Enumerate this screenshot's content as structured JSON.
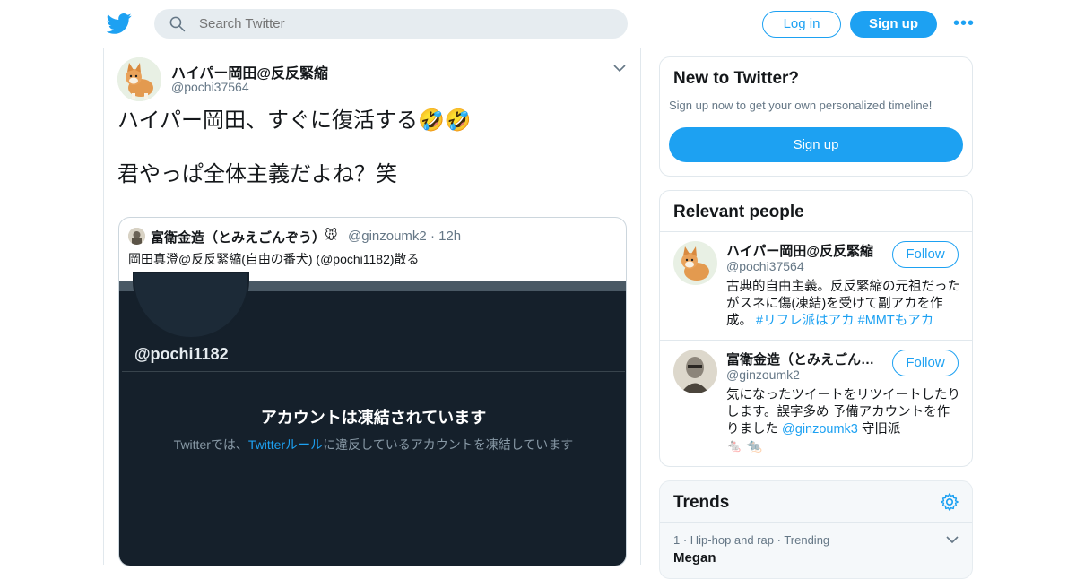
{
  "header": {
    "search_placeholder": "Search Twitter",
    "login_label": "Log in",
    "signup_label": "Sign up",
    "more_label": "•••"
  },
  "tweet": {
    "author_name": "ハイパー岡田@反反緊縮",
    "author_handle": "@pochi37564",
    "text": "ハイパー岡田、すぐに復活する🤣🤣\n\n君やっぱ全体主義だよね？笑",
    "quote": {
      "author_name": "富衛金造（とみえごんぞう）",
      "author_emoji": "🐭",
      "author_handle": "@ginzoumk2",
      "time": "· 12h",
      "text": "岡田真澄@反反緊縮(自由の番犬) (@pochi1182)散る",
      "card": {
        "handle": "@pochi1182",
        "title": "アカウントは凍結されています",
        "sub_prefix": "Twitterでは、",
        "sub_link": "Twitterルール",
        "sub_suffix": "に違反しているアカウントを凍結しています"
      }
    }
  },
  "sidebar": {
    "new_to_twitter": {
      "title": "New to Twitter?",
      "subtitle": "Sign up now to get your own personalized timeline!",
      "button": "Sign up"
    },
    "relevant_people": {
      "title": "Relevant people",
      "people": [
        {
          "name": "ハイパー岡田@反反緊縮",
          "handle": "@pochi37564",
          "follow": "Follow",
          "bio_text": "古典的自由主義。反反緊縮の元祖だったがスネに傷(凍結)を受けて副アカを作成。",
          "bio_tags": "#リフレ派はアカ #MMTもアカ"
        },
        {
          "name": "富衛金造（とみえごんぞう）",
          "handle": "@ginzoumk2",
          "follow": "Follow",
          "bio_text": "気になったツイートをリツイートしたりします。誤字多め 予備アカウントを作りました",
          "bio_mention": "@ginzoumk3",
          "bio_tail": "守旧派",
          "bio_emoji": "🐁 🐀"
        }
      ]
    },
    "trends": {
      "title": "Trends",
      "items": [
        {
          "meta": "1 · Hip-hop and rap · Trending",
          "name": "Megan"
        }
      ]
    }
  }
}
